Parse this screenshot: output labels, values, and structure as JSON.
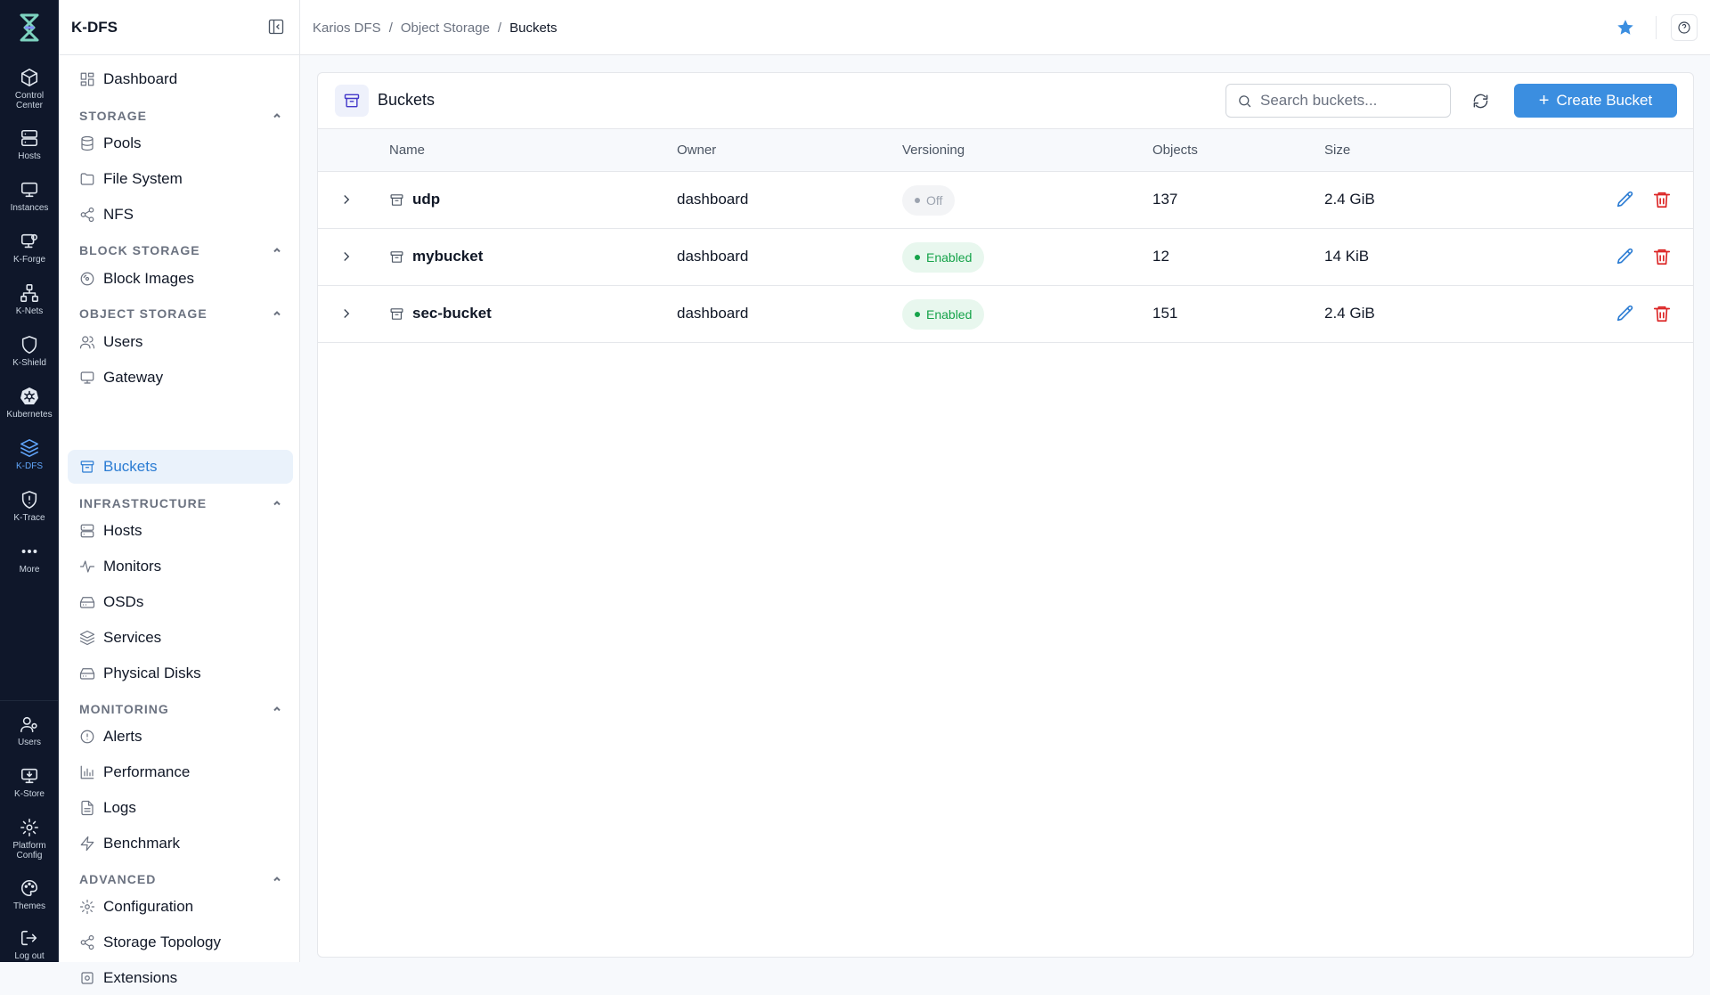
{
  "rail": {
    "items": [
      {
        "label": "Control\nCenter",
        "icon": "cube-icon"
      },
      {
        "label": "Hosts",
        "icon": "server-icon"
      },
      {
        "label": "Instances",
        "icon": "monitor-icon"
      },
      {
        "label": "K-Forge",
        "icon": "forge-icon"
      },
      {
        "label": "K-Nets",
        "icon": "network-icon"
      },
      {
        "label": "K-Shield",
        "icon": "shield-icon"
      },
      {
        "label": "Kubernetes",
        "icon": "kubernetes-icon"
      },
      {
        "label": "K-DFS",
        "icon": "layers-icon"
      },
      {
        "label": "K-Trace",
        "icon": "trace-icon"
      },
      {
        "label": "More",
        "icon": "more-icon"
      },
      {
        "label": "Users",
        "icon": "users-icon"
      },
      {
        "label": "K-Store",
        "icon": "store-icon"
      },
      {
        "label": "Platform\nConfig",
        "icon": "gear-icon"
      },
      {
        "label": "Themes",
        "icon": "palette-icon"
      },
      {
        "label": "Log out",
        "icon": "logout-icon"
      }
    ]
  },
  "sidebar": {
    "title": "K-DFS",
    "dashboard": "Dashboard",
    "sections": {
      "storage": "STORAGE",
      "block_storage": "BLOCK STORAGE",
      "object_storage": "OBJECT STORAGE",
      "infrastructure": "INFRASTRUCTURE",
      "monitoring": "MONITORING",
      "advanced": "ADVANCED"
    },
    "items": {
      "pools": "Pools",
      "file_system": "File System",
      "nfs": "NFS",
      "block_images": "Block Images",
      "users": "Users",
      "gateway": "Gateway",
      "buckets": "Buckets",
      "hosts": "Hosts",
      "monitors": "Monitors",
      "osds": "OSDs",
      "services": "Services",
      "physical_disks": "Physical Disks",
      "alerts": "Alerts",
      "performance": "Performance",
      "logs": "Logs",
      "benchmark": "Benchmark",
      "configuration": "Configuration",
      "storage_topology": "Storage Topology",
      "extensions": "Extensions"
    }
  },
  "breadcrumb": [
    "Karios DFS",
    "Object Storage",
    "Buckets"
  ],
  "panel": {
    "title": "Buckets",
    "search_placeholder": "Search buckets...",
    "create_label": "Create Bucket"
  },
  "table": {
    "headers": {
      "name": "Name",
      "owner": "Owner",
      "versioning": "Versioning",
      "objects": "Objects",
      "size": "Size"
    },
    "rows": [
      {
        "name": "udp",
        "owner": "dashboard",
        "versioning": "Off",
        "objects": "137",
        "size": "2.4 GiB"
      },
      {
        "name": "mybucket",
        "owner": "dashboard",
        "versioning": "Enabled",
        "objects": "12",
        "size": "14 KiB"
      },
      {
        "name": "sec-bucket",
        "owner": "dashboard",
        "versioning": "Enabled",
        "objects": "151",
        "size": "2.4 GiB"
      }
    ]
  },
  "colors": {
    "accent": "#3b8ee0",
    "active_nav": "#2b7cd3",
    "enabled": "#16a34a",
    "delete": "#dc2626",
    "rail_bg": "#0f172a"
  }
}
